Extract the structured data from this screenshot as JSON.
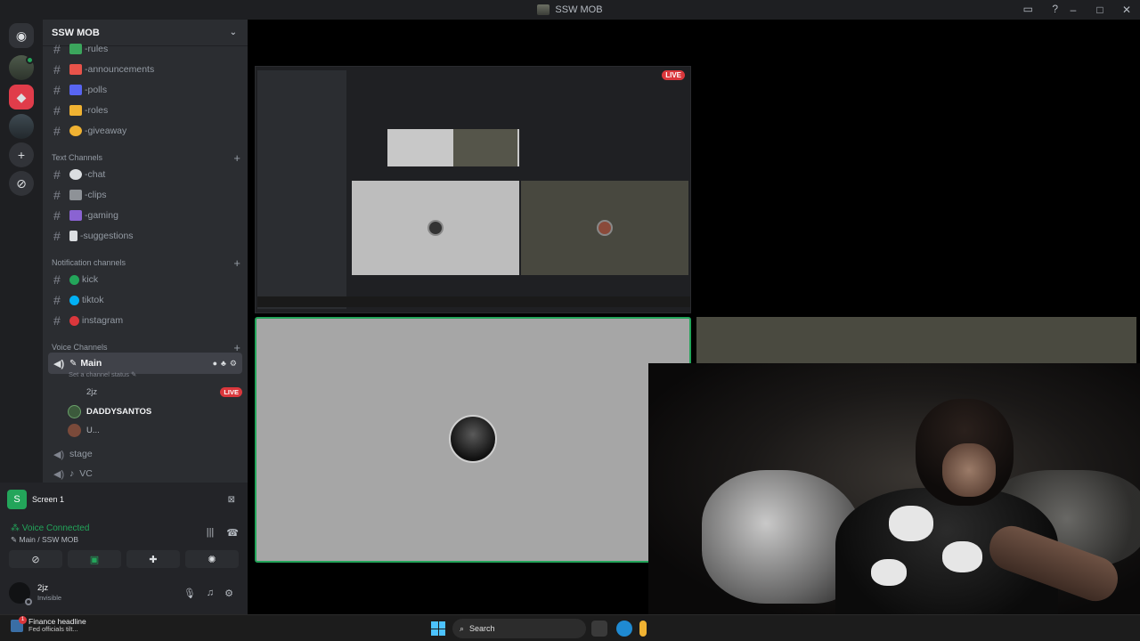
{
  "window": {
    "title": "SSW MOB"
  },
  "server": {
    "name": "SSW MOB"
  },
  "channels_top": [
    {
      "name": "-rules",
      "color": "#3ba55c"
    },
    {
      "name": "-announcements",
      "color": "#e8534a"
    },
    {
      "name": "-polls",
      "color": "#5865f2"
    },
    {
      "name": "-roles",
      "color": "#f0b232"
    },
    {
      "name": "-giveaway",
      "color": "#f0b232"
    }
  ],
  "text_category": "Text Channels",
  "text_channels": [
    {
      "name": "-chat"
    },
    {
      "name": "-clips"
    },
    {
      "name": "-gaming"
    },
    {
      "name": "-suggestions"
    }
  ],
  "notification_category": "Notification channels",
  "notification_channels": [
    {
      "name": "kick",
      "color": "#23a55a"
    },
    {
      "name": "tiktok",
      "color": "#00b0f4"
    },
    {
      "name": "instagram",
      "color": "#da373c"
    }
  ],
  "voice_category": "Voice Channels",
  "voice_main": {
    "name": "Main",
    "status_hint": "Set a channel status",
    "users": [
      {
        "name": "2jz",
        "live": "LIVE"
      },
      {
        "name": "DADDYSANTOS"
      },
      {
        "name": "U..."
      }
    ]
  },
  "voice_others": [
    {
      "name": "stage"
    },
    {
      "name": "VC"
    }
  ],
  "stream_panel": {
    "title": "Screen 1"
  },
  "voice_connection": {
    "status": "Voice Connected",
    "location": "Main / SSW MOB"
  },
  "user": {
    "name": "2jz",
    "status": "Invisible"
  },
  "stage": {
    "live_label": "LIVE"
  },
  "taskbar": {
    "news_title": "Finance headline",
    "news_sub": "Fed officials tilt...",
    "news_badge": "1",
    "search_label": "Search"
  }
}
